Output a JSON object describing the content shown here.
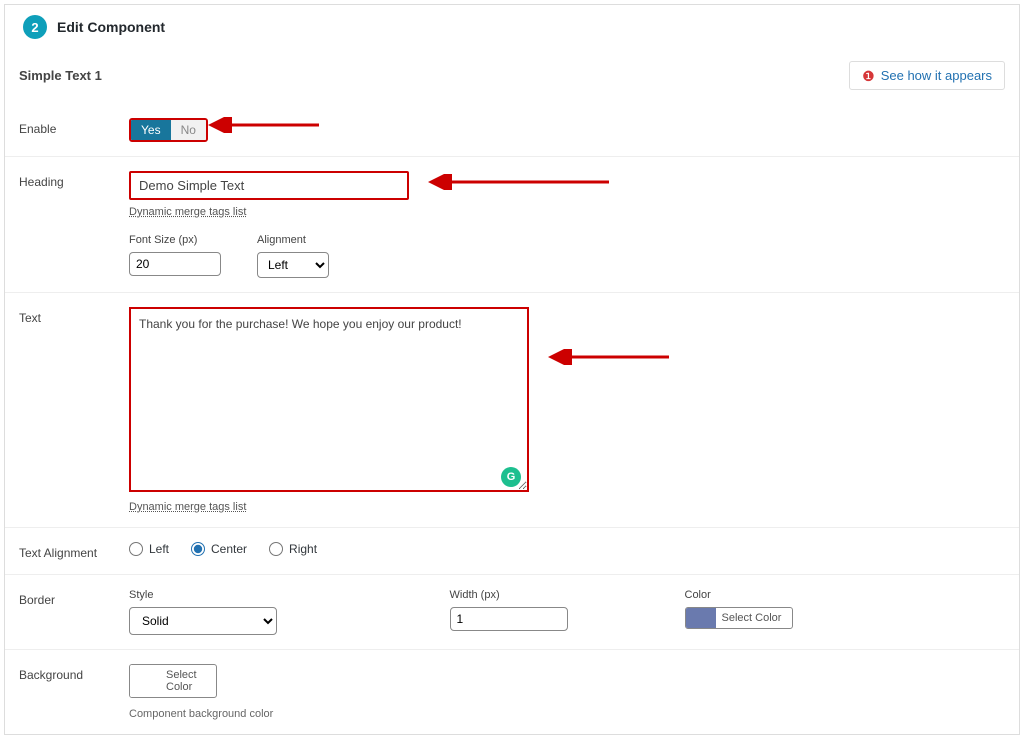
{
  "header": {
    "step_num": "2",
    "title": "Edit Component"
  },
  "component_label": "Simple Text 1",
  "see_how": "See how it appears",
  "enable": {
    "label": "Enable",
    "yes": "Yes",
    "no": "No"
  },
  "heading": {
    "label": "Heading",
    "value": "Demo Simple Text",
    "merge_link": "Dynamic merge tags list",
    "font_size_label": "Font Size (px)",
    "font_size_value": "20",
    "alignment_label": "Alignment",
    "alignment_value": "Left"
  },
  "text": {
    "label": "Text",
    "value": "Thank you for the purchase! We hope you enjoy our product!",
    "merge_link": "Dynamic merge tags list"
  },
  "text_alignment": {
    "label": "Text Alignment",
    "options": {
      "left": "Left",
      "center": "Center",
      "right": "Right"
    },
    "selected": "center"
  },
  "border": {
    "label": "Border",
    "style_label": "Style",
    "style_value": "Solid",
    "width_label": "Width (px)",
    "width_value": "1",
    "color_label": "Color",
    "color_btn": "Select Color",
    "color_value": "#6a7aae"
  },
  "background": {
    "label": "Background",
    "color_btn": "Select Color",
    "helper": "Component background color"
  }
}
